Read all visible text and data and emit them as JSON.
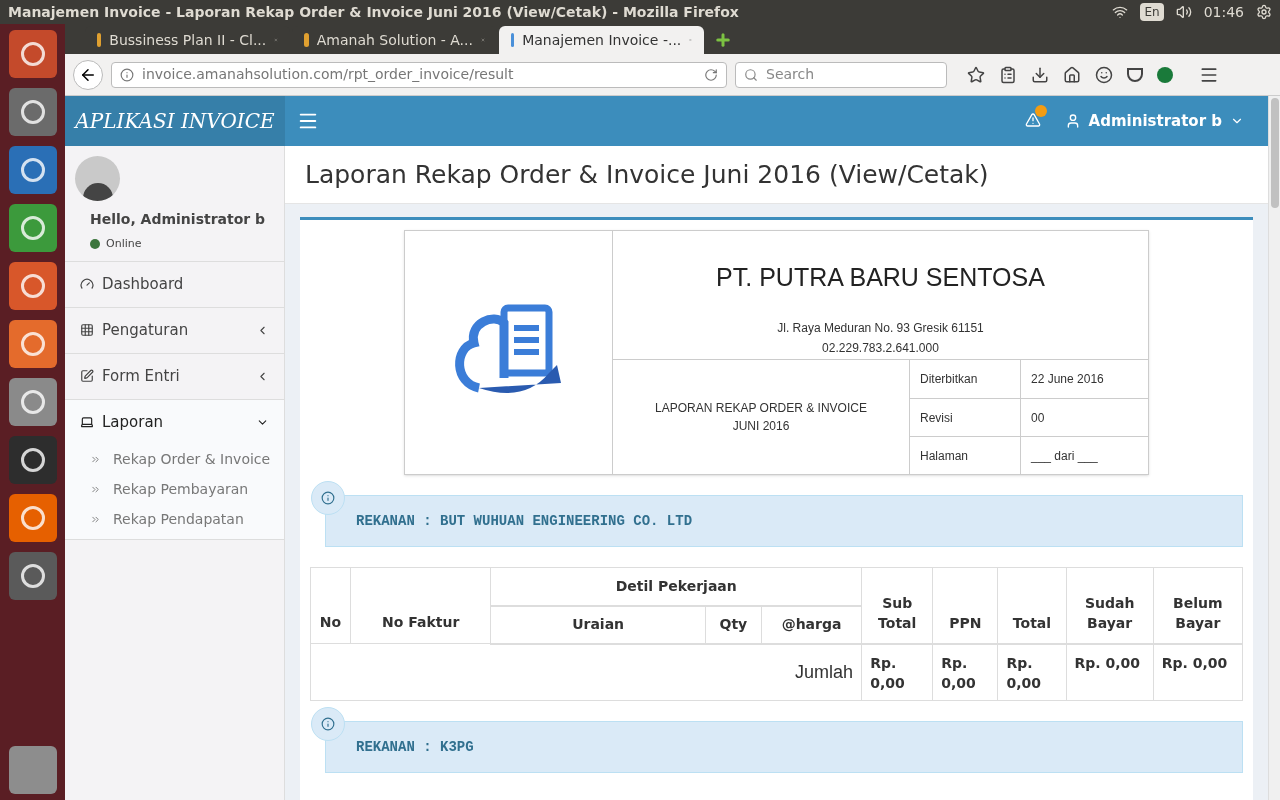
{
  "system_bar": {
    "title": "Manajemen Invoice - Laporan Rekap Order & Invoice Juni 2016 (View/Cetak) - Mozilla Firefox",
    "keyboard": "En",
    "time": "01:46"
  },
  "browser": {
    "tabs": [
      {
        "label": "Bussiness Plan II - Cl...",
        "selected": false
      },
      {
        "label": "Amanah Solution - A...",
        "selected": false
      },
      {
        "label": "Manajemen Invoice -...",
        "selected": true
      }
    ],
    "url": "invoice.amanahsolution.com/rpt_order_invoice/result",
    "search": {
      "placeholder": "Search"
    }
  },
  "app": {
    "brand": "APLIKASI INVOICE",
    "user": "Administrator b"
  },
  "sidebar": {
    "greeting": "Hello, Administrator b",
    "status": "Online",
    "items": [
      {
        "label": "Dashboard",
        "kind": "link",
        "selected": false
      },
      {
        "label": "Pengaturan",
        "kind": "menu",
        "selected": false,
        "expanded": false
      },
      {
        "label": "Form Entri",
        "kind": "menu",
        "selected": false,
        "expanded": false
      },
      {
        "label": "Laporan",
        "kind": "menu",
        "selected": true,
        "expanded": true,
        "children": [
          {
            "label": "Rekap Order & Invoice"
          },
          {
            "label": "Rekap Pembayaran"
          },
          {
            "label": "Rekap Pendapatan"
          }
        ]
      }
    ]
  },
  "page_title": "Laporan Rekap Order & Invoice Juni 2016 (View/Cetak)",
  "report": {
    "company": "PT. PUTRA BARU SENTOSA",
    "address": "Jl. Raya Meduran No. 93 Gresik 61151",
    "tax_number": "02.229.783.2.641.000",
    "title_lines": [
      "LAPORAN REKAP ORDER & INVOICE",
      "JUNI 2016"
    ],
    "meta": [
      {
        "label": "Diterbitkan",
        "value": "22 June 2016"
      },
      {
        "label": "Revisi",
        "value": "00"
      },
      {
        "label": "Halaman",
        "value": "___ dari ___"
      }
    ]
  },
  "sections": [
    {
      "partner": "REKANAN : BUT WUHUAN ENGINEERING CO. LTD",
      "table": {
        "columns": {
          "no": "No",
          "invoice_no": "No Faktur",
          "work_detail": "Detil Pekerjaan",
          "description": "Uraian",
          "qty": "Qty",
          "price": "@harga",
          "subtotal": "Sub Total",
          "tax": "PPN",
          "total": "Total",
          "paid": "Sudah Bayar",
          "unpaid": "Belum Bayar"
        },
        "sum_label": "Jumlah",
        "sums": [
          "Rp. 0,00",
          "Rp. 0,00",
          "Rp. 0,00",
          "Rp. 0,00",
          "Rp. 0,00"
        ]
      }
    },
    {
      "partner": "REKANAN : K3PG"
    }
  ]
}
